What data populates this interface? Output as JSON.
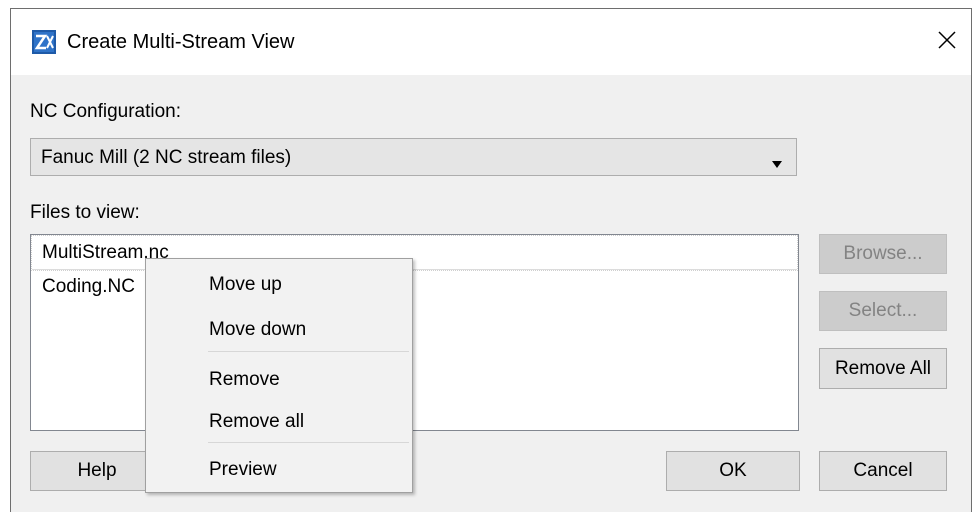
{
  "window": {
    "title": "Create Multi-Stream View",
    "app_icon": "zx-app-icon",
    "close_icon": "close-icon"
  },
  "nc_config": {
    "label": "NC Configuration:",
    "selected": "Fanuc Mill (2 NC stream files)"
  },
  "files": {
    "label": "Files to view:",
    "items": [
      "MultiStream.nc",
      "Coding.NC"
    ]
  },
  "side_buttons": {
    "browse": "Browse...",
    "select": "Select...",
    "remove_all": "Remove All"
  },
  "bottom_buttons": {
    "help": "Help",
    "ok": "OK",
    "cancel": "Cancel"
  },
  "context_menu": {
    "items": [
      "Move up",
      "Move down",
      "Remove",
      "Remove all",
      "Preview"
    ]
  },
  "colors": {
    "dialog_bg": "#f0f0f0",
    "menu_bg": "#f2f2f2",
    "icon_blue": "#1e5aa8"
  }
}
